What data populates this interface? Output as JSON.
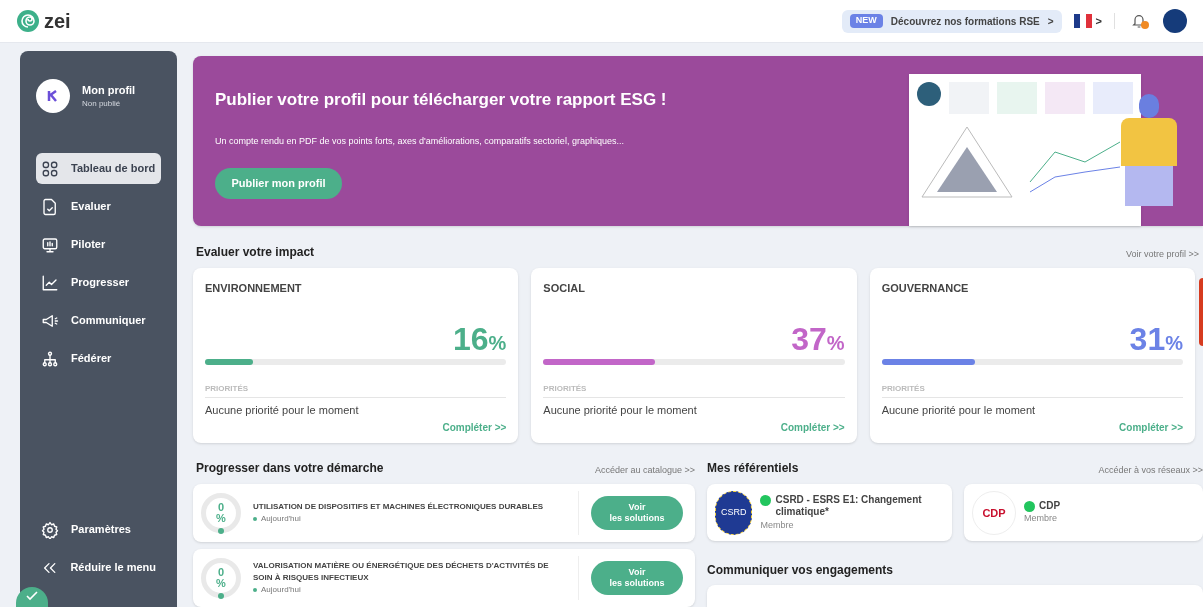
{
  "header": {
    "logo_text": "zei",
    "promo": {
      "badge": "NEW",
      "text": "Découvrez nos formations RSE",
      "chevron": ">"
    },
    "language_chevron": ">",
    "notification": true
  },
  "sidebar": {
    "profile": {
      "name": "Mon profil",
      "status": "Non publié"
    },
    "items": [
      {
        "label": "Tableau de bord",
        "selected": true
      },
      {
        "label": "Evaluer",
        "selected": false
      },
      {
        "label": "Piloter",
        "selected": false
      },
      {
        "label": "Progresser",
        "selected": false
      },
      {
        "label": "Communiquer",
        "selected": false
      },
      {
        "label": "Fédérer",
        "selected": false
      }
    ],
    "bottom": [
      {
        "label": "Paramètres"
      },
      {
        "label": "Réduire le menu"
      }
    ]
  },
  "banner": {
    "title": "Publier votre profil pour télécharger votre rapport ESG !",
    "text": "Un compte rendu en PDF de vos points forts, axes d'améliorations, comparatifs sectoriel, graphiques...",
    "button": "Publier mon profil"
  },
  "impact": {
    "title": "Evaluer votre impact",
    "link": "Voir votre profil >>",
    "cards": [
      {
        "title": "ENVIRONNEMENT",
        "value": "16",
        "unit": "%",
        "level": 0.16,
        "color": "#4caf8a",
        "priorities_label": "PRIORITÉS",
        "priorities_text": "Aucune priorité pour le moment",
        "link": "Compléter >>"
      },
      {
        "title": "SOCIAL",
        "value": "37",
        "unit": "%",
        "level": 0.37,
        "color": "#c266c8",
        "priorities_label": "PRIORITÉS",
        "priorities_text": "Aucune priorité pour le moment",
        "link": "Compléter >>"
      },
      {
        "title": "GOUVERNANCE",
        "value": "31",
        "unit": "%",
        "level": 0.31,
        "color": "#6b82e6",
        "priorities_label": "PRIORITÉS",
        "priorities_text": "Aucune priorité pour le moment",
        "link": "Compléter >>"
      }
    ]
  },
  "progress": {
    "title": "Progresser dans votre démarche",
    "link": "Accéder au catalogue >>",
    "rows": [
      {
        "value": "0",
        "unit": "%",
        "title": "UTILISATION DE DISPOSITIFS ET MACHINES ÉLECTRONIQUES DURABLES",
        "date": "Aujourd'hui",
        "button_lines": [
          "Voir",
          "les solutions"
        ]
      },
      {
        "value": "0",
        "unit": "%",
        "title": "VALORISATION MATIÈRE OU ÉNERGÉTIQUE DES DÉCHETS D'ACTIVITÉS DE SOIN À RISQUES INFECTIEUX",
        "date": "Aujourd'hui",
        "button_lines": [
          "Voir",
          "les solutions"
        ]
      }
    ]
  },
  "referentiels": {
    "title": "Mes référentiels",
    "link": "Accéder à vos réseaux >>",
    "items": [
      {
        "kind": "eu",
        "logo_text": "CSRD",
        "name": "CSRD - ESRS E1: Changement climatique*",
        "role": "Membre",
        "color": "#22c55e"
      },
      {
        "kind": "cdp",
        "logo_text": "CDP",
        "name": "CDP",
        "role": "Membre",
        "color": "#22c55e"
      }
    ]
  },
  "communiquer": {
    "title": "Communiquer vos engagements"
  }
}
